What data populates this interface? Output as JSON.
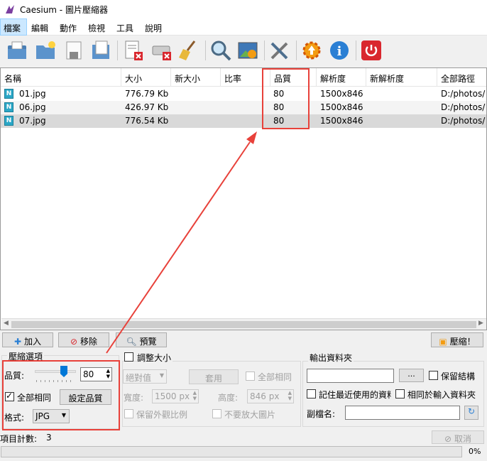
{
  "window": {
    "title": "Caesium - 圖片壓縮器"
  },
  "menu": [
    "檔案",
    "編輯",
    "動作",
    "檢視",
    "工具",
    "說明"
  ],
  "toolbar": [
    "open-folder-icon",
    "folder-add-icon",
    "save-icon",
    "document-icon",
    "remove-item-icon",
    "clear-drive-icon",
    "broom-icon",
    "search-icon",
    "preview-image-icon",
    "tools-icon",
    "update-gear-icon",
    "info-icon",
    "power-icon"
  ],
  "filelist": {
    "columns": [
      "名稱",
      "大小",
      "新大小",
      "比率",
      "品質",
      "解析度",
      "新解析度",
      "全部路徑"
    ],
    "rows": [
      {
        "icon": "N",
        "name": "01.jpg",
        "size": "776.79 Kb",
        "new_size": "",
        "ratio": "",
        "quality": "80",
        "resolution": "1500x846",
        "new_resolution": "",
        "path": "D:/photos/"
      },
      {
        "icon": "N",
        "name": "06.jpg",
        "size": "426.97 Kb",
        "new_size": "",
        "ratio": "",
        "quality": "80",
        "resolution": "1500x846",
        "new_resolution": "",
        "path": "D:/photos/"
      },
      {
        "icon": "N",
        "name": "07.jpg",
        "size": "776.54 Kb",
        "new_size": "",
        "ratio": "",
        "quality": "80",
        "resolution": "1500x846",
        "new_resolution": "",
        "path": "D:/photos/"
      }
    ]
  },
  "actions": {
    "add": "加入",
    "remove": "移除",
    "preview": "預覽",
    "compress": "壓縮！"
  },
  "compression": {
    "title": "壓縮選項",
    "quality_label": "品質:",
    "quality_value": "80",
    "quality_slider": 0.8,
    "apply_all": "全部相同",
    "set_quality": "設定品質",
    "format_label": "格式:",
    "format_value": "JPG"
  },
  "resize": {
    "title": "調整大小",
    "mode": "絕對值",
    "apply": "套用",
    "same_all": "全部相同",
    "width_label": "寬度:",
    "width_value": "1500 px",
    "height_label": "高度:",
    "height_value": "846 px",
    "keep_ratio": "保留外觀比例",
    "no_enlarge": "不要放大圖片"
  },
  "output": {
    "title": "輸出資料夾",
    "browse": "...",
    "keep_structure": "保留結構",
    "remember": "記住最近使用的資料",
    "same_as_input": "相同於輸入資料夾",
    "suffix_label": "副檔名:"
  },
  "status": {
    "count_label": "項目計數:",
    "count": "3",
    "cancel": "取消",
    "progress": "0%"
  },
  "colors": {
    "highlight": "#e8413a",
    "selection": "#d9d9d9",
    "accent": "#0078d7"
  }
}
